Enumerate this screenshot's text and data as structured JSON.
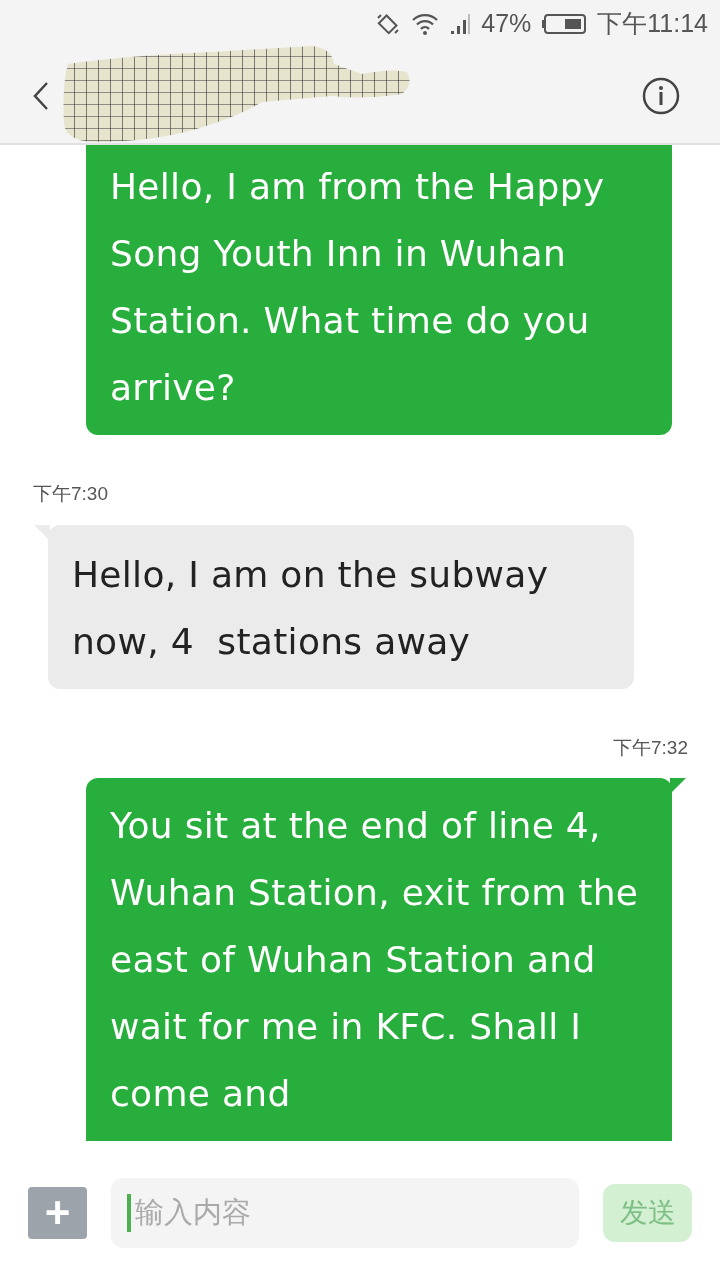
{
  "status_bar": {
    "battery_percent": "47%",
    "time": "下午11:14"
  },
  "messages": [
    {
      "kind": "sent",
      "text": "Hello, I am from the Happy Song Youth Inn in Wuhan Station. What time do you arrive?"
    },
    {
      "kind": "time",
      "text": "下午7:30"
    },
    {
      "kind": "received",
      "text": "Hello, I am on the subway now, 4  stations away"
    },
    {
      "kind": "time",
      "text": "下午7:32"
    },
    {
      "kind": "sent",
      "text": "You sit at the end of line 4, Wuhan Station, exit from the east of Wuhan Station and wait for me in KFC. Shall I come and"
    }
  ],
  "composer": {
    "add_button": "+",
    "placeholder": "输入内容",
    "send_button": {
      "label": "发送",
      "disabled": true
    }
  }
}
